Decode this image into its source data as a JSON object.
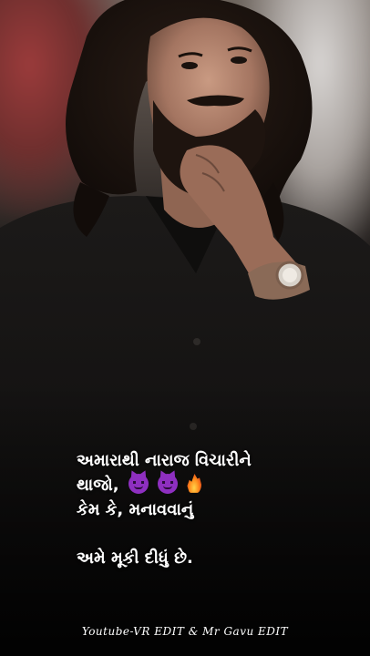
{
  "caption": {
    "line1": "અમારાથી નારાજ વિચારીને",
    "line2": "થાજો,",
    "line2_emojis": [
      "devil-icon",
      "devil-icon",
      "fire-icon"
    ],
    "line3": "કેમ કે, મનાવવાનું",
    "line4": "અમે મૂકી દીધું છે."
  },
  "footer": {
    "credit": "Youtube-VR EDIT & Mr Gavu EDIT"
  },
  "colors": {
    "text": "#ffffff",
    "shirt": "#151313",
    "devil_emoji": "#8e2fc0",
    "fire_emoji": "#ff8a1c"
  }
}
